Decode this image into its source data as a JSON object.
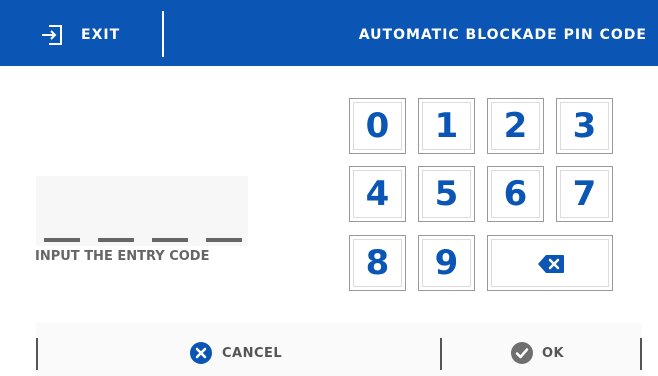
{
  "header": {
    "exit_label": "EXIT",
    "title": "AUTOMATIC BLOCKADE PIN CODE"
  },
  "code_entry": {
    "hint": "INPUT THE ENTRY CODE"
  },
  "keypad": {
    "keys": [
      "0",
      "1",
      "2",
      "3",
      "4",
      "5",
      "6",
      "7",
      "8",
      "9"
    ]
  },
  "footer": {
    "cancel_label": "CANCEL",
    "ok_label": "OK"
  },
  "colors": {
    "brand_blue": "#0b56b5",
    "text_gray": "#555555"
  },
  "icons": {
    "exit": "exit-icon",
    "backspace": "backspace-icon",
    "cancel": "cancel-x-circle-icon",
    "ok": "check-circle-icon"
  }
}
